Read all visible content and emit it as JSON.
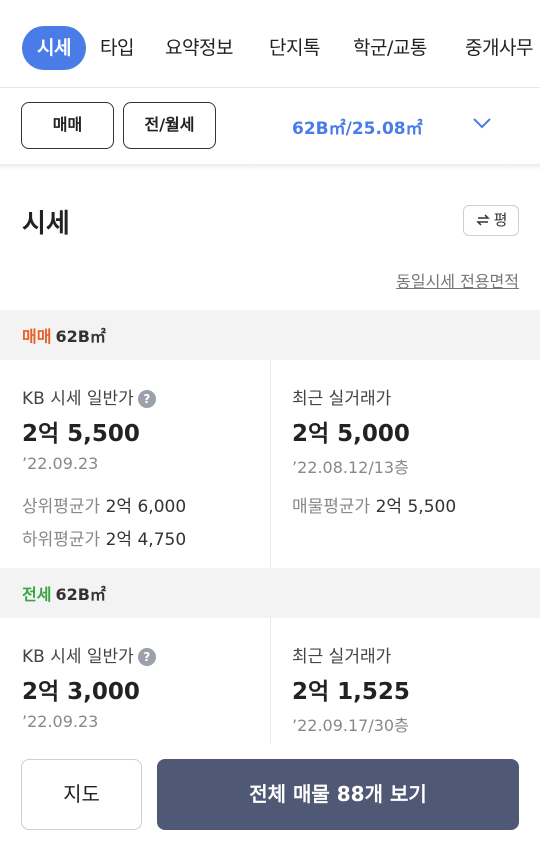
{
  "tabs": [
    "시세",
    "타입",
    "요약정보",
    "단지톡",
    "학군/교통",
    "중개사무"
  ],
  "filter": {
    "trade_label": "매매",
    "rent_label": "전/월세",
    "area": "62B㎡/25.08㎡",
    "dropdown_icon": "chevron-down-icon"
  },
  "section": {
    "title": "시세",
    "unit_toggle": "평",
    "unit_icon": "swap-icon",
    "same_price_link": "동일시세 전용면적"
  },
  "sale": {
    "type": "매매",
    "size": "62B㎡",
    "kb_label": "KB 시세 일반가",
    "kb_price": "2억 5,500",
    "kb_date": "’22.09.23",
    "recent_label": "최근 실거래가",
    "recent_price": "2억 5,000",
    "recent_date": "’22.08.12/13층",
    "upper_label": "상위평균가",
    "upper_value": "2억 6,000",
    "lower_label": "하위평균가",
    "lower_value": "2억 4,750",
    "listing_label": "매물평균가",
    "listing_value": "2억 5,500"
  },
  "jeonse": {
    "type": "전세",
    "size": "62B㎡",
    "kb_label": "KB 시세 일반가",
    "kb_price": "2억 3,000",
    "kb_date": "’22.09.23",
    "recent_label": "최근 실거래가",
    "recent_price": "2억 1,525",
    "recent_date": "’22.09.17/30층"
  },
  "bottom": {
    "map_label": "지도",
    "all_listings_label": "전체 매물 88개 보기"
  },
  "colors": {
    "accent": "#4a7ce8",
    "sale": "#e8602c",
    "jeonse": "#3aa545",
    "cta": "#4f5874"
  }
}
